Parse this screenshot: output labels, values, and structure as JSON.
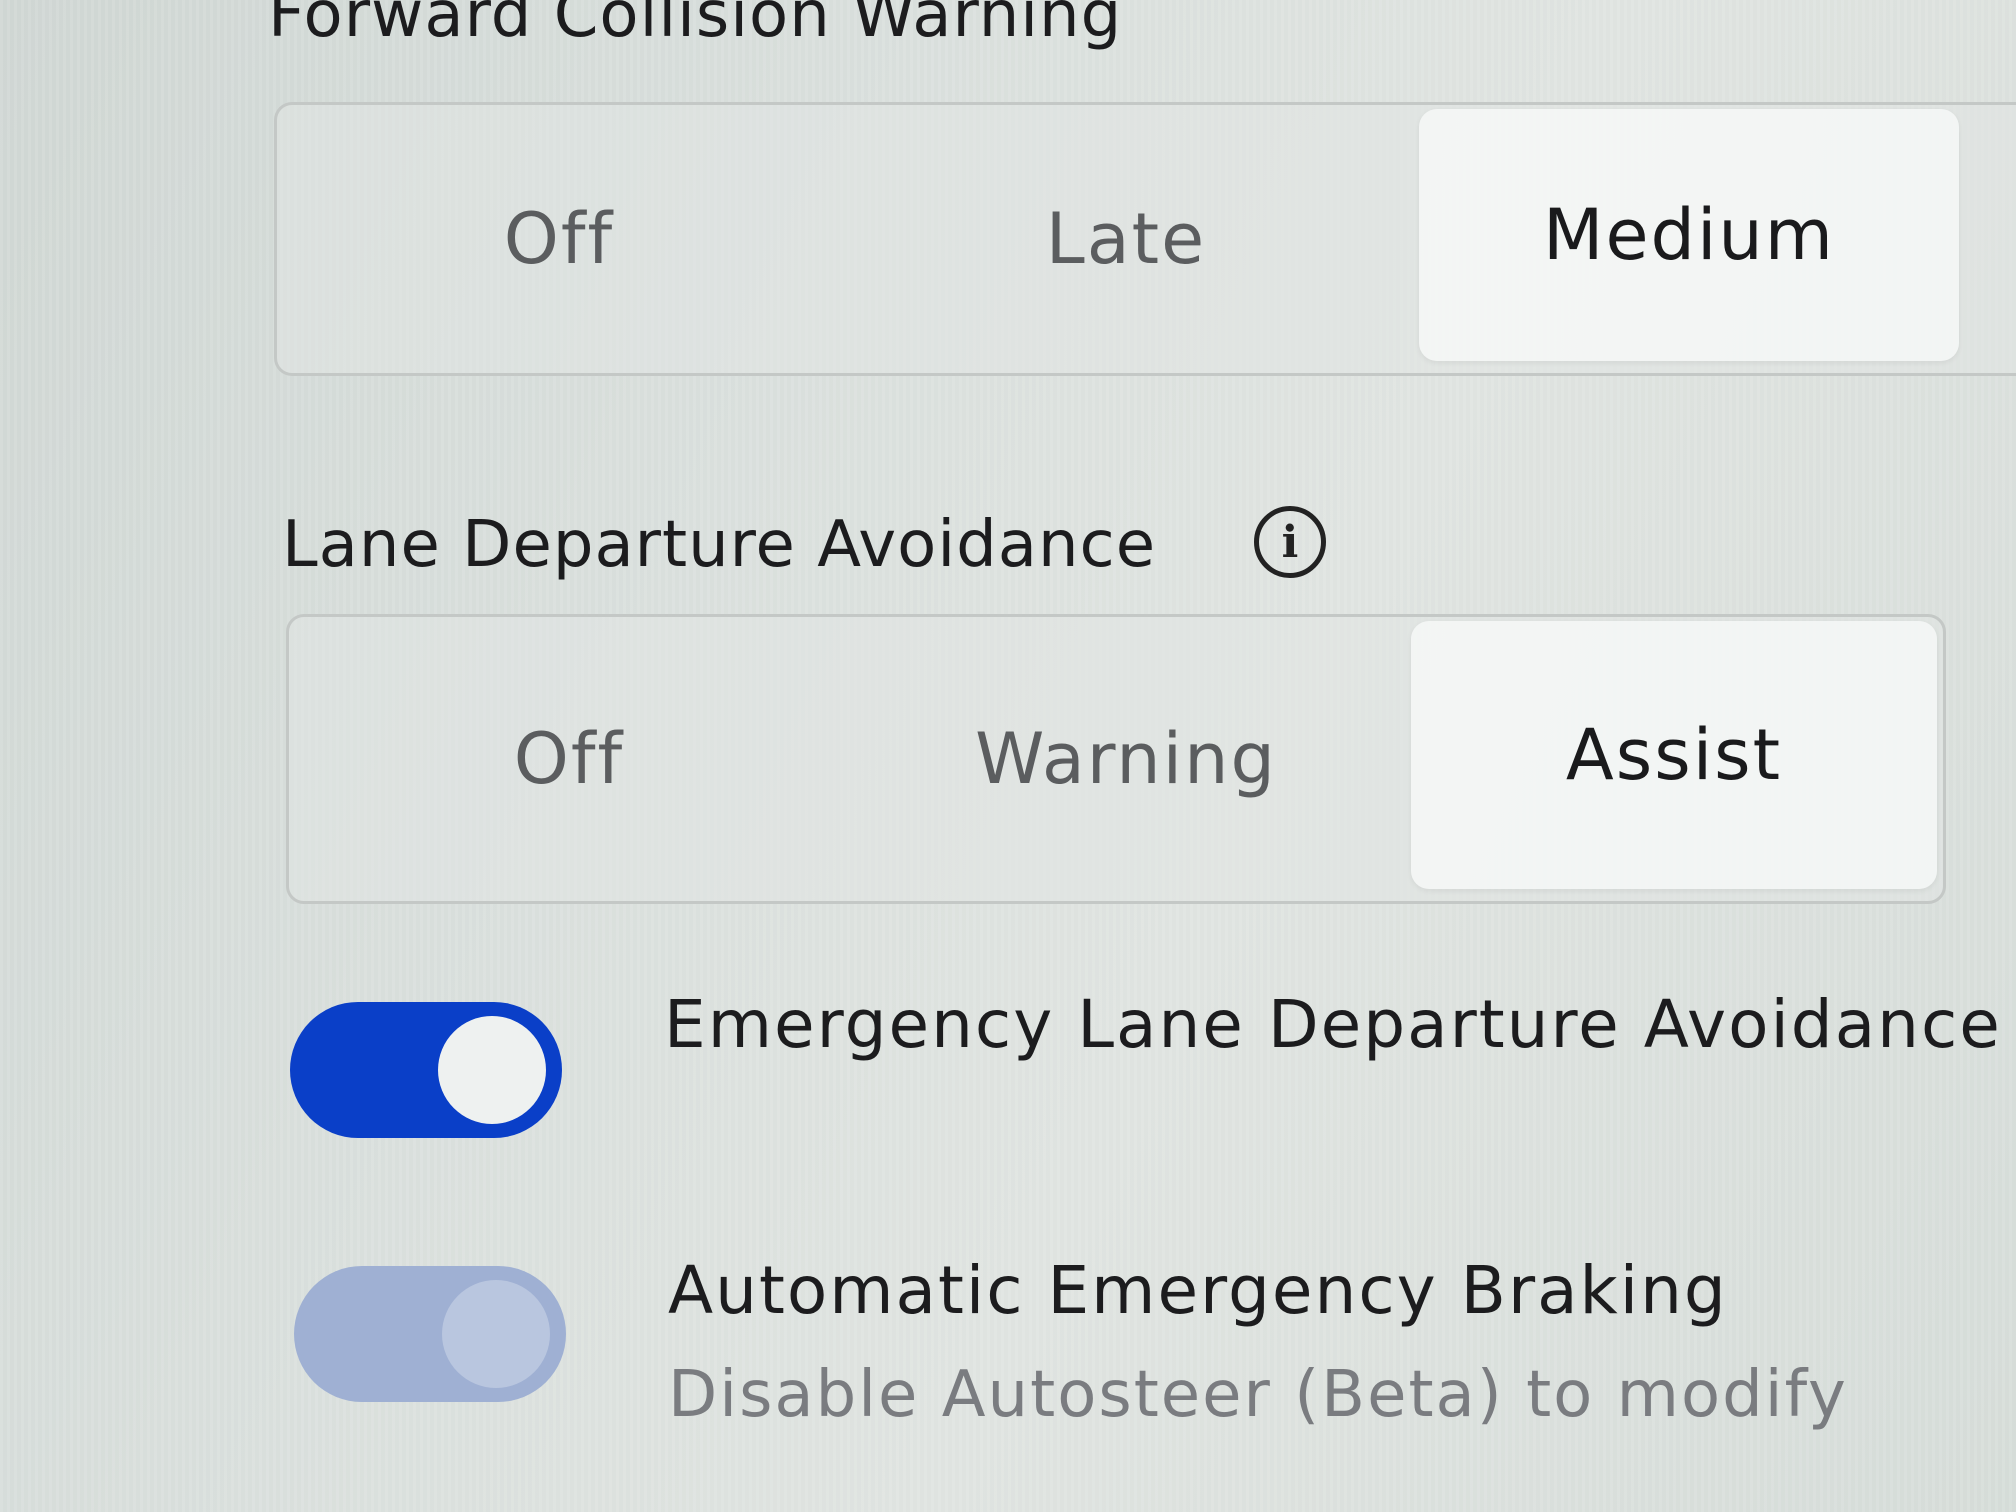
{
  "forward_collision_warning": {
    "title": "Forward Collision Warning",
    "options": [
      "Off",
      "Late",
      "Medium"
    ],
    "selected": "Medium"
  },
  "lane_departure_avoidance": {
    "title": "Lane Departure Avoidance",
    "info_icon": "info-icon",
    "options": [
      "Off",
      "Warning",
      "Assist"
    ],
    "selected": "Assist"
  },
  "toggles": [
    {
      "label": "Emergency Lane Departure Avoidance",
      "state": "on",
      "enabled": true,
      "color": "#0a3fc8"
    },
    {
      "label": "Automatic Emergency Braking",
      "sublabel": "Disable Autosteer (Beta) to modify",
      "state": "on",
      "enabled": false,
      "color": "#9fb0d3"
    }
  ]
}
